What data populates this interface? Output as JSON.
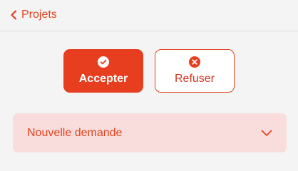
{
  "header": {
    "back_label": "Projets"
  },
  "actions": {
    "accept_label": "Accepter",
    "refuse_label": "Refuser"
  },
  "dropdown": {
    "label": "Nouvelle demande"
  },
  "colors": {
    "accent": "#e63e1f",
    "dropdown_bg": "#f9dcdc",
    "background": "#f4f4f4"
  },
  "icons": {
    "back": "chevron-left-icon",
    "accept": "check-circle-icon",
    "refuse": "x-circle-icon",
    "dropdown": "chevron-down-icon"
  }
}
